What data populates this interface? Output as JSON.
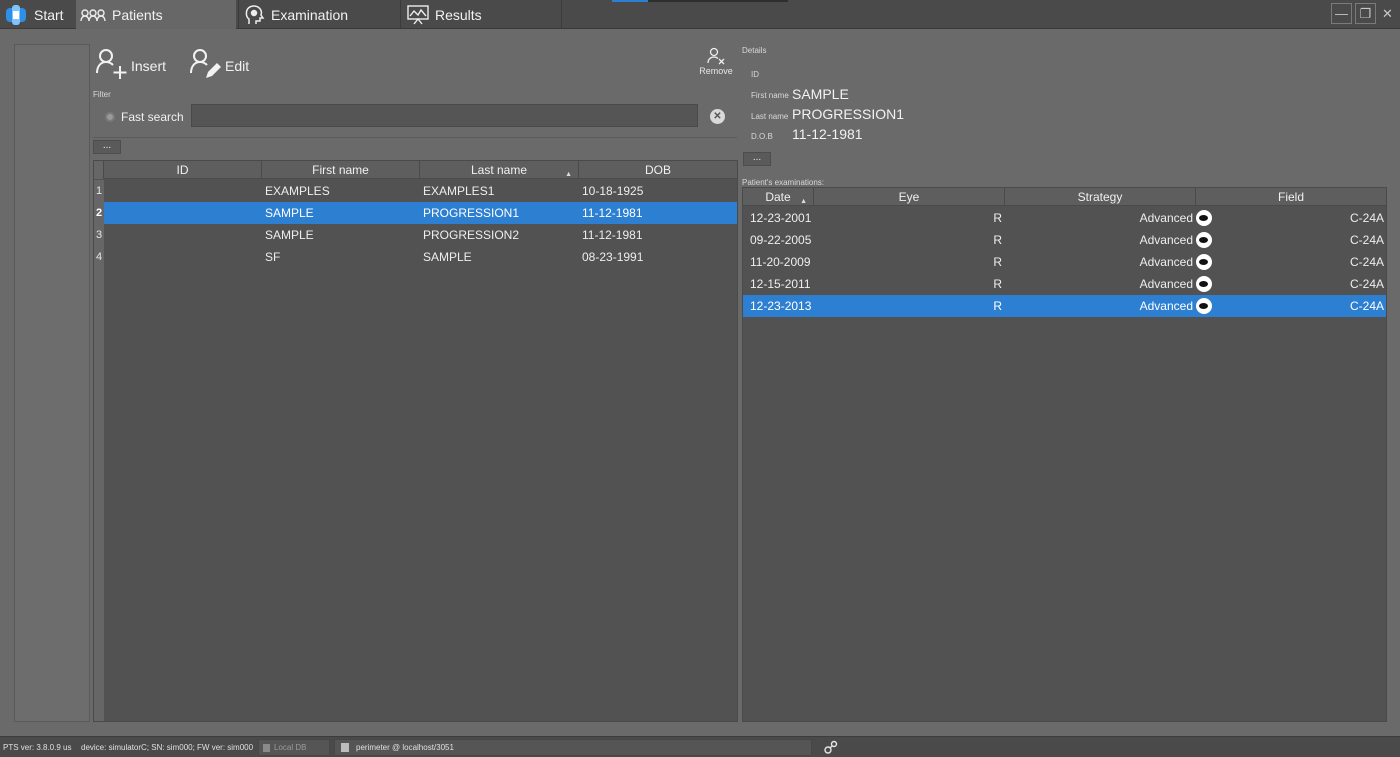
{
  "tabs": {
    "start": "Start",
    "patients": "Patients",
    "examination": "Examination",
    "results": "Results"
  },
  "window_controls": {
    "minimize": "—",
    "restore": "❐",
    "close": "✕"
  },
  "toolbar": {
    "insert": "Insert",
    "edit": "Edit",
    "remove": "Remove"
  },
  "filter": {
    "label": "Filter",
    "fast_search": "Fast search",
    "search_value": "",
    "more_button": "..."
  },
  "patients_table": {
    "columns": [
      "ID",
      "First name",
      "Last name",
      "DOB"
    ],
    "sorted_column": "Last name",
    "rows": [
      {
        "num": "1",
        "id": "",
        "first": "EXAMPLES",
        "last": "EXAMPLES1",
        "dob": "10-18-1925",
        "selected": false
      },
      {
        "num": "2",
        "id": "",
        "first": "SAMPLE",
        "last": "PROGRESSION1",
        "dob": "11-12-1981",
        "selected": true
      },
      {
        "num": "3",
        "id": "",
        "first": "SAMPLE",
        "last": "PROGRESSION2",
        "dob": "11-12-1981",
        "selected": false
      },
      {
        "num": "4",
        "id": "",
        "first": "SF",
        "last": "SAMPLE",
        "dob": "08-23-1991",
        "selected": false
      }
    ]
  },
  "details": {
    "heading": "Details",
    "id_label": "ID",
    "id_value": "",
    "first_label": "First name",
    "first_value": "SAMPLE",
    "last_label": "Last name",
    "last_value": "PROGRESSION1",
    "dob_label": "D.O.B",
    "dob_value": "11-12-1981",
    "more_button": "..."
  },
  "exams": {
    "heading": "Patient's examinations:",
    "columns": [
      "Date",
      "Eye",
      "Strategy",
      "Field"
    ],
    "sorted_column": "Date",
    "rows": [
      {
        "date": "12-23-2001",
        "eye": "R",
        "strategy": "Advanced",
        "field": "C-24A",
        "selected": false
      },
      {
        "date": "09-22-2005",
        "eye": "R",
        "strategy": "Advanced",
        "field": "C-24A",
        "selected": false
      },
      {
        "date": "11-20-2009",
        "eye": "R",
        "strategy": "Advanced",
        "field": "C-24A",
        "selected": false
      },
      {
        "date": "12-15-2011",
        "eye": "R",
        "strategy": "Advanced",
        "field": "C-24A",
        "selected": false
      },
      {
        "date": "12-23-2013",
        "eye": "R",
        "strategy": "Advanced",
        "field": "C-24A",
        "selected": true
      }
    ]
  },
  "status": {
    "version": "PTS ver: 3.8.0.9 us",
    "device": "device: simulatorC; SN: sim000; FW ver: sim000",
    "local_db": "Local DB",
    "db_connection": "perimeter @ localhost/3051"
  },
  "colors": {
    "selection": "#2d7fd1",
    "background": "#6a6a6a",
    "tabbar": "#4a4a4a",
    "table": "#525252"
  },
  "icons": [
    "app-logo-icon",
    "patients-icon",
    "examination-icon",
    "results-icon",
    "insert-user-icon",
    "edit-user-icon",
    "remove-user-icon",
    "clear-search-icon",
    "eye-field-icon",
    "database-icon",
    "settings-cog-icon"
  ]
}
